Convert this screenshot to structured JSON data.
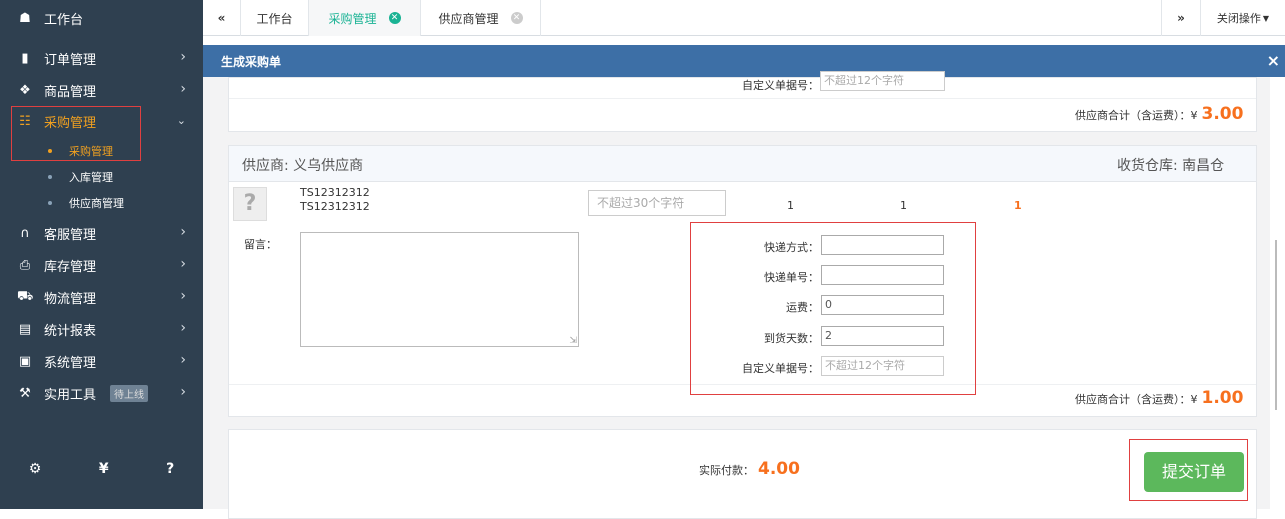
{
  "sidebar": {
    "workbench": "工作台",
    "items": [
      {
        "label": "订单管理",
        "icon": "clipboard-icon"
      },
      {
        "label": "商品管理",
        "icon": "cube-icon"
      },
      {
        "label": "采购管理",
        "icon": "cart-icon"
      },
      {
        "label": "客服管理",
        "icon": "headset-icon"
      },
      {
        "label": "库存管理",
        "icon": "printer-icon"
      },
      {
        "label": "物流管理",
        "icon": "truck-icon"
      },
      {
        "label": "统计报表",
        "icon": "document-icon"
      },
      {
        "label": "系统管理",
        "icon": "monitor-icon"
      },
      {
        "label": "实用工具",
        "icon": "wrench-icon"
      }
    ],
    "sub_items": [
      "采购管理",
      "入库管理",
      "供应商管理"
    ],
    "tool_badge": "待上线",
    "footer_icons": [
      "gear-icon",
      "yen-icon",
      "help-icon"
    ]
  },
  "tabs": {
    "items": [
      "工作台",
      "采购管理",
      "供应商管理"
    ],
    "close_ops": "关闭操作"
  },
  "modal": {
    "title": "生成采购单"
  },
  "prev_supplier": {
    "custom_no_label": "自定义单据号：",
    "custom_no_placeholder": "不超过12个字符",
    "total_label": "供应商合计（含运费）：¥",
    "total_value": "3.00"
  },
  "supplier": {
    "name_label": "供应商: 义乌供应商",
    "warehouse_label": "收货仓库: 南昌仓",
    "product_code_1": "TS12312312",
    "product_code_2": "TS12312312",
    "remark_placeholder": "不超过30个字符",
    "qty1": "1",
    "qty2": "1",
    "qty3": "1",
    "message_label": "留言：",
    "express_label": "快递方式：",
    "express_value": "",
    "tracking_label": "快递单号：",
    "tracking_value": "",
    "freight_label": "运费：",
    "freight_value": "0",
    "days_label": "到货天数：",
    "days_value": "2",
    "custom_no_label": "自定义单据号：",
    "custom_no_placeholder": "不超过12个字符",
    "total_label": "供应商合计（含运费）：¥",
    "total_value": "1.00"
  },
  "footer": {
    "actual_pay_label": "实际付款：",
    "actual_pay_value": "4.00",
    "submit_label": "提交订单"
  },
  "colors": {
    "sidebar_bg": "#2f4050",
    "header_blue": "#3d6fa6",
    "accent_orange": "#f7701e",
    "submit_green": "#5cb85c",
    "active_tab": "#1ab394",
    "highlight_red": "#e04040"
  }
}
